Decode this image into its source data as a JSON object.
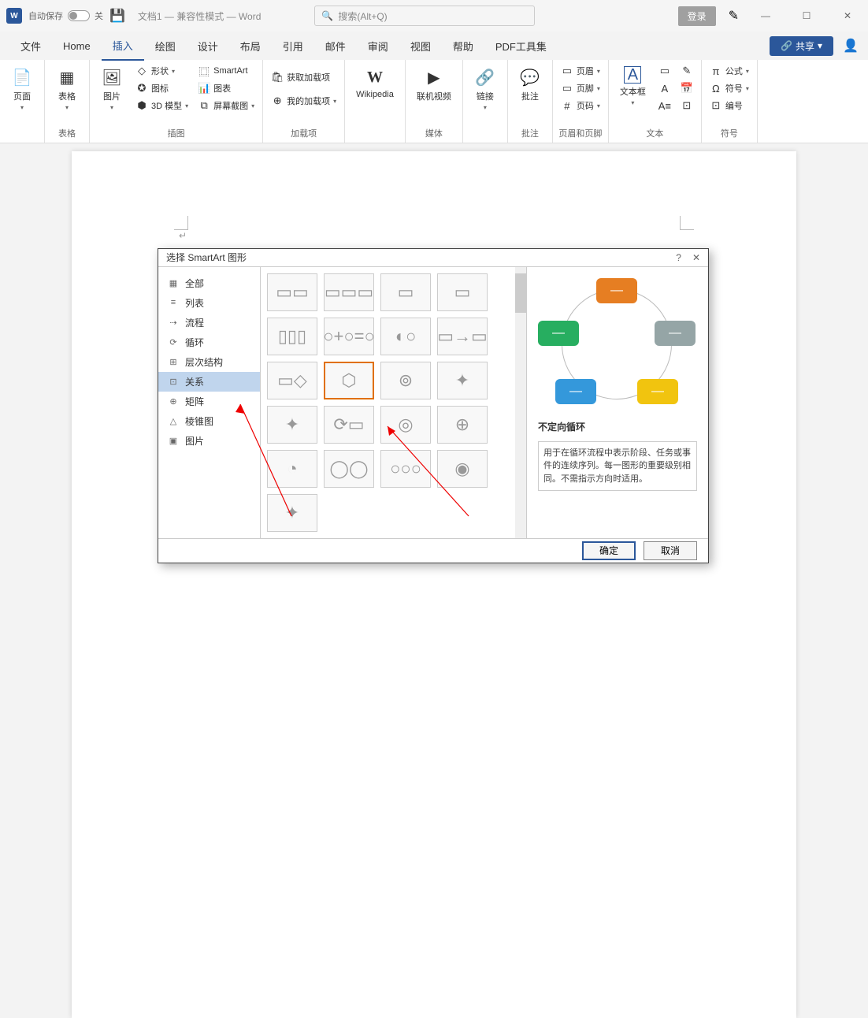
{
  "titlebar": {
    "autosave_label": "自动保存",
    "autosave_state": "关",
    "doc_title": "文档1 — 兼容性模式 — Word",
    "search_placeholder": "搜索(Alt+Q)",
    "login": "登录"
  },
  "menu": {
    "items": [
      "文件",
      "Home",
      "插入",
      "绘图",
      "设计",
      "布局",
      "引用",
      "邮件",
      "审阅",
      "视图",
      "帮助",
      "PDF工具集"
    ],
    "active_index": 2,
    "share": "共享"
  },
  "ribbon": {
    "groups": [
      {
        "label": "",
        "big": [
          {
            "name": "页面",
            "icon": "📄"
          }
        ]
      },
      {
        "label": "表格",
        "big": [
          {
            "name": "表格",
            "icon": "▦"
          }
        ]
      },
      {
        "label": "插图",
        "big": [
          {
            "name": "图片",
            "icon": "🖼"
          }
        ],
        "col": [
          {
            "name": "形状",
            "icon": "◇"
          },
          {
            "name": "图标",
            "icon": "✪"
          },
          {
            "name": "3D 模型",
            "icon": "⬢"
          }
        ],
        "col2": [
          {
            "name": "SmartArt",
            "icon": "⿴"
          },
          {
            "name": "图表",
            "icon": "📊"
          },
          {
            "name": "屏幕截图",
            "icon": "⧉"
          }
        ]
      },
      {
        "label": "加载项",
        "col": [
          {
            "name": "获取加载项",
            "icon": "🛍"
          },
          {
            "name": "我的加载项",
            "icon": "⊕"
          }
        ]
      },
      {
        "label": "",
        "big": [
          {
            "name": "Wikipedia",
            "icon": "W"
          }
        ]
      },
      {
        "label": "媒体",
        "big": [
          {
            "name": "联机视频",
            "icon": "▶"
          }
        ]
      },
      {
        "label": "",
        "big": [
          {
            "name": "链接",
            "icon": "🔗"
          }
        ]
      },
      {
        "label": "批注",
        "big": [
          {
            "name": "批注",
            "icon": "💬"
          }
        ]
      },
      {
        "label": "页眉和页脚",
        "col": [
          {
            "name": "页眉",
            "icon": "▭"
          },
          {
            "name": "页脚",
            "icon": "▭"
          },
          {
            "name": "页码",
            "icon": "#"
          }
        ]
      },
      {
        "label": "文本",
        "big": [
          {
            "name": "文本框",
            "icon": "A"
          }
        ]
      },
      {
        "label": "符号",
        "col": [
          {
            "name": "公式",
            "icon": "π"
          },
          {
            "name": "符号",
            "icon": "Ω"
          },
          {
            "name": "编号",
            "icon": "⊡"
          }
        ]
      }
    ]
  },
  "dialog": {
    "title": "选择 SmartArt 图形",
    "help": "?",
    "categories": [
      {
        "icon": "▦",
        "label": "全部"
      },
      {
        "icon": "≡",
        "label": "列表"
      },
      {
        "icon": "⇢",
        "label": "流程"
      },
      {
        "icon": "⟳",
        "label": "循环"
      },
      {
        "icon": "⊞",
        "label": "层次结构"
      },
      {
        "icon": "⊡",
        "label": "关系"
      },
      {
        "icon": "⊕",
        "label": "矩阵"
      },
      {
        "icon": "△",
        "label": "棱锥图"
      },
      {
        "icon": "▣",
        "label": "图片"
      }
    ],
    "selected_category": 5,
    "selected_layout": 9,
    "preview": {
      "title": "不定向循环",
      "desc": "用于在循环流程中表示阶段、任务或事件的连续序列。每一图形的重要级别相同。不需指示方向时适用。"
    },
    "ok": "确定",
    "cancel": "取消"
  }
}
